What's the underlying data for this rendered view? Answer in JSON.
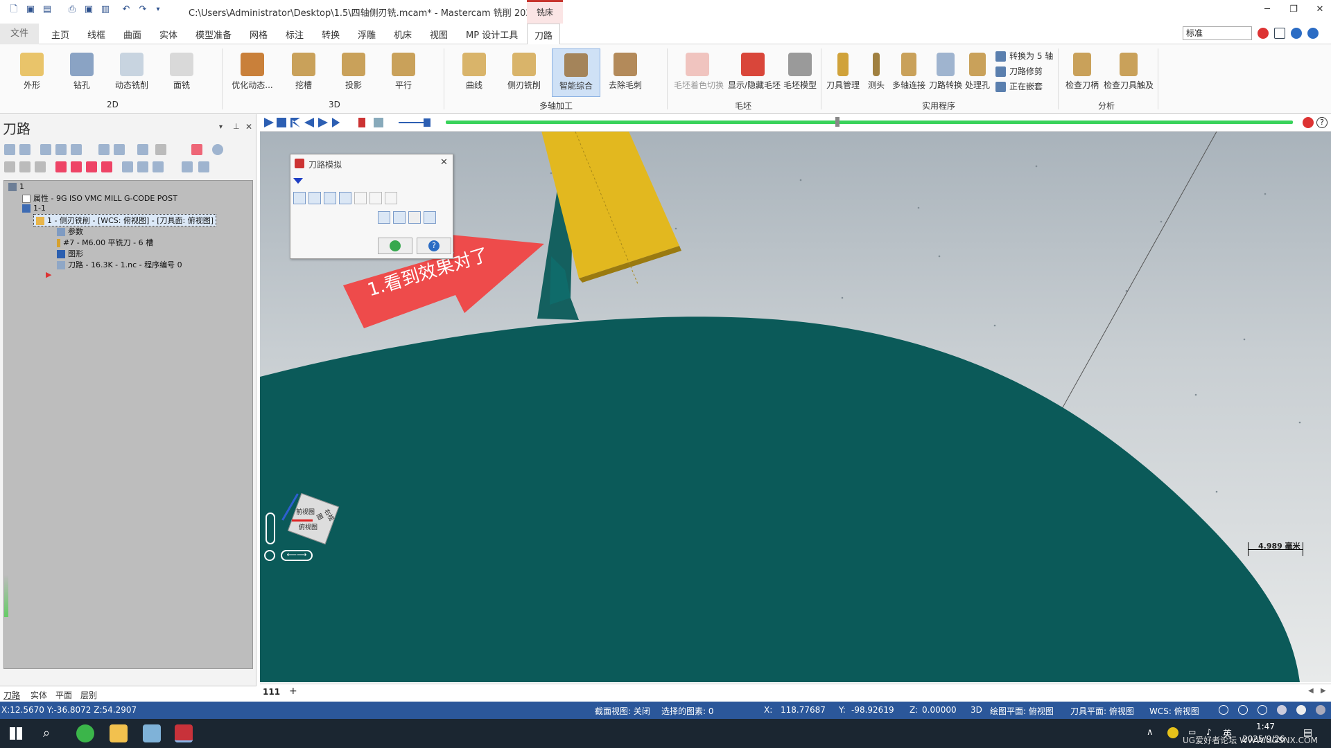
{
  "title": "C:\\Users\\Administrator\\Desktop\\1.5\\四轴侧刃铣.mcam* - Mastercam 铣削 2025",
  "context_tab": "铣床",
  "tabs": [
    "文件",
    "主页",
    "线框",
    "曲面",
    "实体",
    "模型准备",
    "网格",
    "标注",
    "转换",
    "浮雕",
    "机床",
    "视图",
    "MP 设计工具",
    "刀路"
  ],
  "search_value": "标准",
  "ribbon": {
    "groups": [
      "2D",
      "3D",
      "多轴加工",
      "毛坯",
      "实用程序",
      "分析"
    ],
    "buttons_2d": [
      "外形",
      "钻孔",
      "动态铣削",
      "面铣"
    ],
    "buttons_3d": [
      "优化动态...",
      "挖槽",
      "投影",
      "平行"
    ],
    "buttons_multi": [
      "曲线",
      "侧刃铣削",
      "智能综合",
      "去除毛刺"
    ],
    "buttons_stock": [
      "毛坯着色切换",
      "显示/隐藏毛坯",
      "毛坯模型"
    ],
    "buttons_util": [
      "刀具管理",
      "测头",
      "多轴连接",
      "刀路转换",
      "处理孔"
    ],
    "small_util": [
      "转换为 5 轴",
      "刀路修剪",
      "正在嵌套"
    ],
    "buttons_analysis": [
      "检查刀柄",
      "检查刀具触及"
    ]
  },
  "panel": {
    "title": "刀路",
    "tree": [
      "1",
      "属性 - 9G ISO VMC MILL G-CODE POST",
      "1-1",
      "1 - 侧刃铣削 - [WCS: 俯视图] - [刀具面: 俯视图]",
      "参数",
      "#7 - M6.00 平铣刀 - 6  槽",
      "图形",
      "刀路 - 16.3K - 1.nc - 程序编号 0"
    ],
    "bottom_tabs": [
      "刀路",
      "实体",
      "平面",
      "层别"
    ]
  },
  "dialog": {
    "title": "刀路模拟"
  },
  "annotation": "1.看到效果对了",
  "viewcube": {
    "front": "前视图",
    "right": "右视图",
    "bottom": "俯视图"
  },
  "scale": "4.989 毫米",
  "viewport_tab": "111",
  "status": {
    "coords": "X:12.5670   Y:-36.8072   Z:54.2907",
    "section": "截面视图: 关闭",
    "selected": "选择的图素: 0",
    "x_label": "X:",
    "x_val": "118.77687",
    "y_label": "Y:",
    "y_val": "-98.92619",
    "z_label": "Z:",
    "z_val": "0.00000",
    "mode": "3D",
    "draw_plane": "绘图平面: 俯视图",
    "tool_plane": "刀具平面: 俯视图",
    "wcs": "WCS: 俯视图"
  },
  "taskbar": {
    "time": "1:47",
    "date": "2025/9/26",
    "lang": "英",
    "watermark": "UG爱好者论坛 WWW.UGSNX.COM"
  },
  "colors": {
    "accent": "#2b579a",
    "part": "#0b5a59",
    "tool": "#e2b81f",
    "arrow": "#ee4b4b"
  }
}
